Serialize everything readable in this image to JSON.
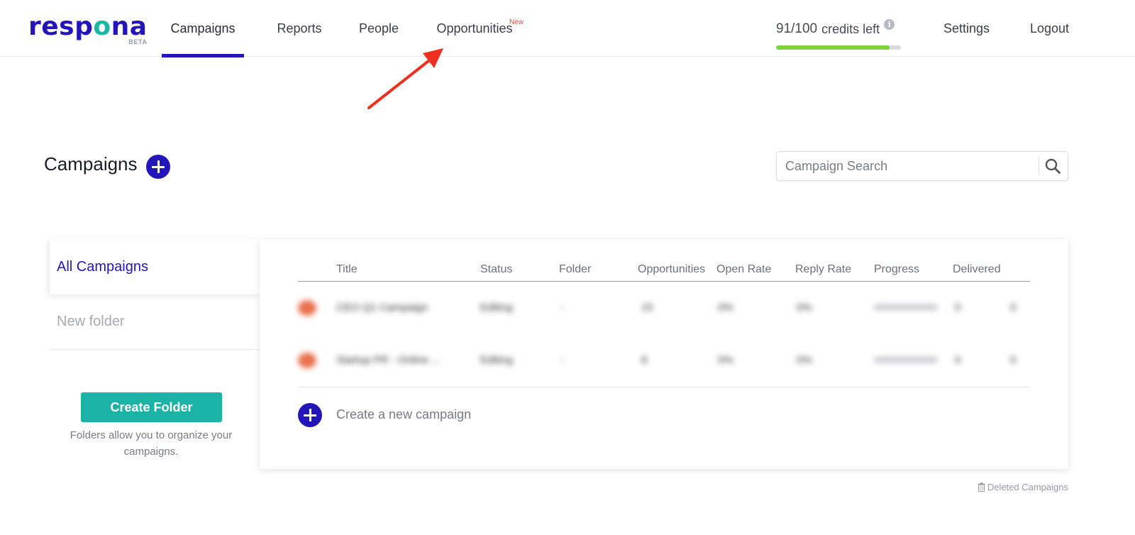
{
  "brand": {
    "name_left": "resp",
    "name_accent": "o",
    "name_right": "na",
    "badge": "BETA",
    "color": "#2415b8",
    "accent": "#19b8a6"
  },
  "nav": {
    "campaigns": "Campaigns",
    "reports": "Reports",
    "people": "People",
    "opportunities": "Opportunities",
    "opportunities_badge": "New"
  },
  "credits": {
    "text": "91/100",
    "suffix": "credits left",
    "used_fraction": 0.91,
    "info_glyph": "i"
  },
  "top_links": {
    "settings": "Settings",
    "logout": "Logout"
  },
  "page": {
    "title": "Campaigns"
  },
  "search": {
    "placeholder": "Campaign Search",
    "value": ""
  },
  "folders": {
    "all": "All Campaigns",
    "new": "New folder",
    "create_button": "Create Folder",
    "hint": "Folders allow you to organize your campaigns."
  },
  "table": {
    "headers": [
      "Title",
      "Status",
      "Folder",
      "Opportunities",
      "Open Rate",
      "Reply Rate",
      "Progress",
      "Delivered"
    ],
    "rows": [
      {
        "title": "CEO Q1 Campaign",
        "status": "Editing",
        "folder": "-",
        "opportunities": "15",
        "open_rate": "0%",
        "reply_rate": "0%",
        "delivered": "0",
        "extra": "0"
      },
      {
        "title": "Startup PR - Online ...",
        "status": "Editing",
        "folder": "-",
        "opportunities": "8",
        "open_rate": "0%",
        "reply_rate": "0%",
        "delivered": "0",
        "extra": "0"
      }
    ],
    "new_campaign": "Create a new campaign"
  },
  "footer": {
    "deleted": "Deleted Campaigns"
  },
  "colors": {
    "primary": "#2415b8",
    "teal": "#1ab3a6",
    "progress_green": "#7ed33a",
    "badge_red": "#e8463a",
    "annotation_arrow": "#f0301e"
  }
}
